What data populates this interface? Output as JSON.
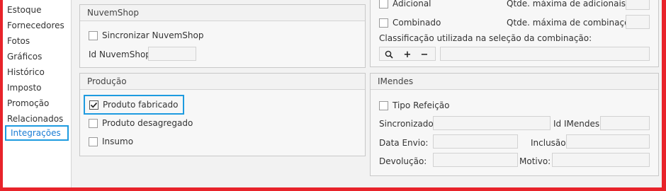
{
  "sidebar": {
    "items": [
      {
        "label": "Estoque"
      },
      {
        "label": "Fornecedores"
      },
      {
        "label": "Fotos"
      },
      {
        "label": "Gráficos"
      },
      {
        "label": "Histórico"
      },
      {
        "label": "Imposto"
      },
      {
        "label": "Promoção"
      },
      {
        "label": "Relacionados"
      },
      {
        "label": "Integrações",
        "active": true
      }
    ]
  },
  "nuvemshop": {
    "title": "NuvemShop",
    "sync_label": "Sincronizar NuvemShop",
    "sync_checked": false,
    "id_label": "Id NuvemShop:",
    "id_value": ""
  },
  "producao": {
    "title": "Produção",
    "fabricado_label": "Produto fabricado",
    "fabricado_checked": true,
    "desagregado_label": "Produto desagregado",
    "desagregado_checked": false,
    "insumo_label": "Insumo",
    "insumo_checked": false
  },
  "adicionais": {
    "adicional_label": "Adicional",
    "max_adicionais_label": "Qtde. máxima de adicionais:",
    "combinado_label": "Combinado",
    "max_combinacoes_label": "Qtde. máxima de combinações:",
    "classificacao_label": "Classificação utilizada na seleção da combinação:",
    "toolbar": {
      "search_icon": "search-icon",
      "add_label": "+",
      "remove_label": "−"
    }
  },
  "imendes": {
    "title": "IMendes",
    "tipo_refeicao_label": "Tipo Refeição",
    "tipo_refeicao_checked": false,
    "sincronizado_label": "Sincronizado:",
    "id_imendes_label": "Id IMendes:",
    "data_envio_label": "Data Envio:",
    "inclusao_label": "Inclusão:",
    "devolucao_label": "Devolução:",
    "motivo_label": "Motivo:"
  },
  "colors": {
    "frame": "#e8232a",
    "accent": "#1e9be0",
    "panel_bg": "#f7f7f7"
  }
}
